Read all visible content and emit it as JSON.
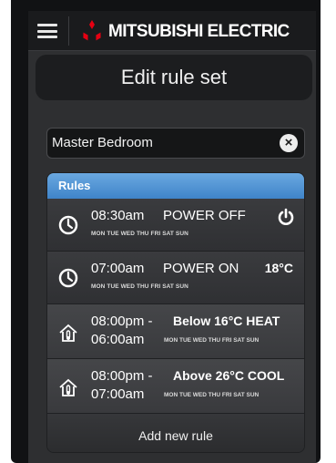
{
  "header": {
    "brand": "MITSUBISHI ELECTRIC",
    "menu_icon": "hamburger-menu-icon",
    "logo_icon": "mitsubishi-three-diamonds-logo",
    "logo_color": "#e60012"
  },
  "title": "Edit rule set",
  "rule_set_name": {
    "value": "Master Bedroom",
    "clear_icon": "clear-x-icon"
  },
  "rules": {
    "header": "Rules",
    "header_color": "#4a90d4",
    "items": [
      {
        "icon": "clock-icon",
        "time": "08:30am",
        "action": "POWER OFF",
        "days": "MON TUE WED THU FRI SAT SUN",
        "right_icon": "power-icon"
      },
      {
        "icon": "clock-icon",
        "time": "07:00am",
        "action": "POWER ON",
        "days": "MON TUE WED THU FRI SAT SUN",
        "right_text": "18°C"
      },
      {
        "icon": "house-thermometer-icon",
        "time_start": "08:00pm -",
        "time_end": "06:00am",
        "action": "Below 16°C HEAT",
        "days": "MON TUE WED THU FRI SAT SUN"
      },
      {
        "icon": "house-thermometer-icon",
        "time_start": "08:00pm -",
        "time_end": "07:00am",
        "action": "Above 26°C COOL",
        "days": "MON TUE WED THU FRI SAT SUN"
      }
    ],
    "add_label": "Add new rule"
  }
}
